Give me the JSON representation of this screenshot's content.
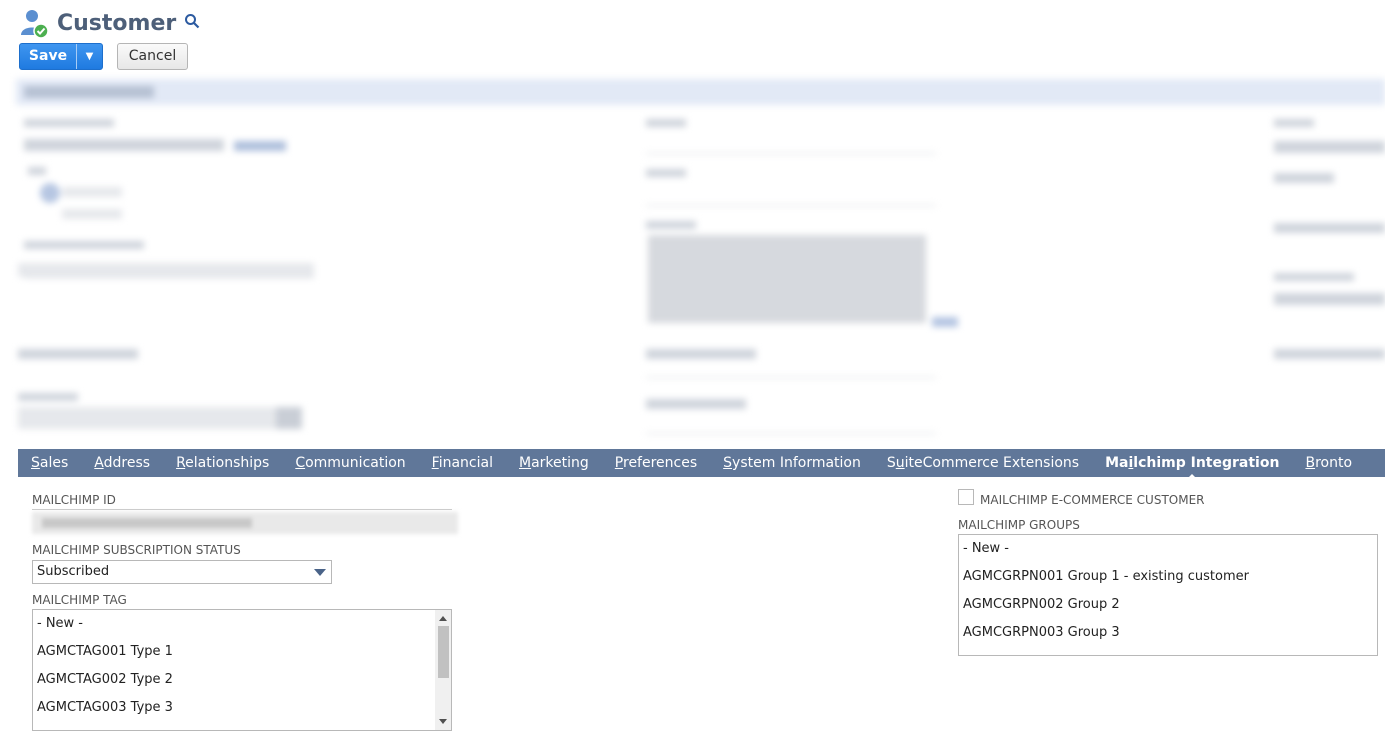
{
  "page": {
    "title": "Customer"
  },
  "toolbar": {
    "save_label": "Save",
    "cancel_label": "Cancel"
  },
  "tabs": [
    {
      "accesskey": "S",
      "rest": "ales"
    },
    {
      "accesskey": "A",
      "rest": "ddress"
    },
    {
      "accesskey": "R",
      "rest": "elationships"
    },
    {
      "accesskey": "C",
      "rest": "ommunication"
    },
    {
      "accesskey": "F",
      "rest": "inancial"
    },
    {
      "accesskey": "M",
      "rest": "arketing"
    },
    {
      "accesskey": "P",
      "rest": "references"
    },
    {
      "accesskey": "S",
      "rest": "ystem Information"
    },
    {
      "before": "S",
      "accesskey": "u",
      "rest": "iteCommerce Extensions"
    },
    {
      "before": "Ma",
      "accesskey": "i",
      "rest": "lchimp Integration",
      "active": true
    },
    {
      "accesskey": "B",
      "rest": "ronto"
    }
  ],
  "mailchimp": {
    "id_label": "MAILCHIMP ID",
    "status_label": "MAILCHIMP SUBSCRIPTION STATUS",
    "status_value": "Subscribed",
    "tag_label": "MAILCHIMP TAG",
    "tags": [
      "- New -",
      "AGMCTAG001 Type 1",
      "AGMCTAG002 Type 2",
      "AGMCTAG003 Type 3"
    ],
    "ecommerce_label": "MAILCHIMP E-COMMERCE CUSTOMER",
    "groups_label": "MAILCHIMP GROUPS",
    "groups": [
      "- New -",
      "AGMCGRPN001 Group 1 - existing customer",
      "AGMCGRPN002 Group 2",
      "AGMCGRPN003 Group 3"
    ]
  },
  "colors": {
    "accent": "#1f7ae0",
    "tabbar": "#607799",
    "title": "#4d5f79"
  }
}
